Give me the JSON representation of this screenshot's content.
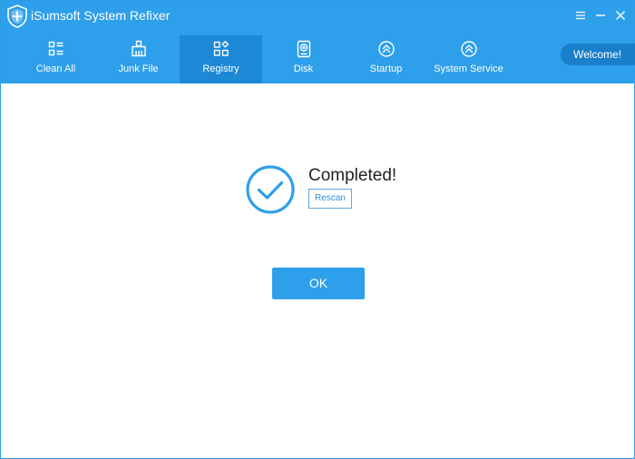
{
  "window": {
    "title": "iSumsoft System Refixer",
    "controls": [
      {
        "name": "menu",
        "icon": "hamburger-menu-icon"
      },
      {
        "name": "minimize",
        "icon": "minimize-icon"
      },
      {
        "name": "close",
        "icon": "close-icon"
      }
    ]
  },
  "nav": {
    "tabs": [
      {
        "label": "Clean All",
        "icon": "list-grid-icon",
        "active": false
      },
      {
        "label": "Junk File",
        "icon": "broom-icon",
        "active": false
      },
      {
        "label": "Registry",
        "icon": "registry-blocks-icon",
        "active": true
      },
      {
        "label": "Disk",
        "icon": "disk-drive-icon",
        "active": false
      },
      {
        "label": "Startup",
        "icon": "chevron-up-circle-icon",
        "active": false
      },
      {
        "label": "System Service",
        "icon": "chevron-up-circle-icon",
        "active": false
      }
    ],
    "welcome_label": "Welcome!"
  },
  "result": {
    "status": "Completed!",
    "rescan_label": "Rescan",
    "ok_label": "OK"
  },
  "colors": {
    "header": "#2e9fea",
    "active_tab": "#1d88d6",
    "welcome_bg": "#1a7fca",
    "accent": "#2e9fea"
  }
}
